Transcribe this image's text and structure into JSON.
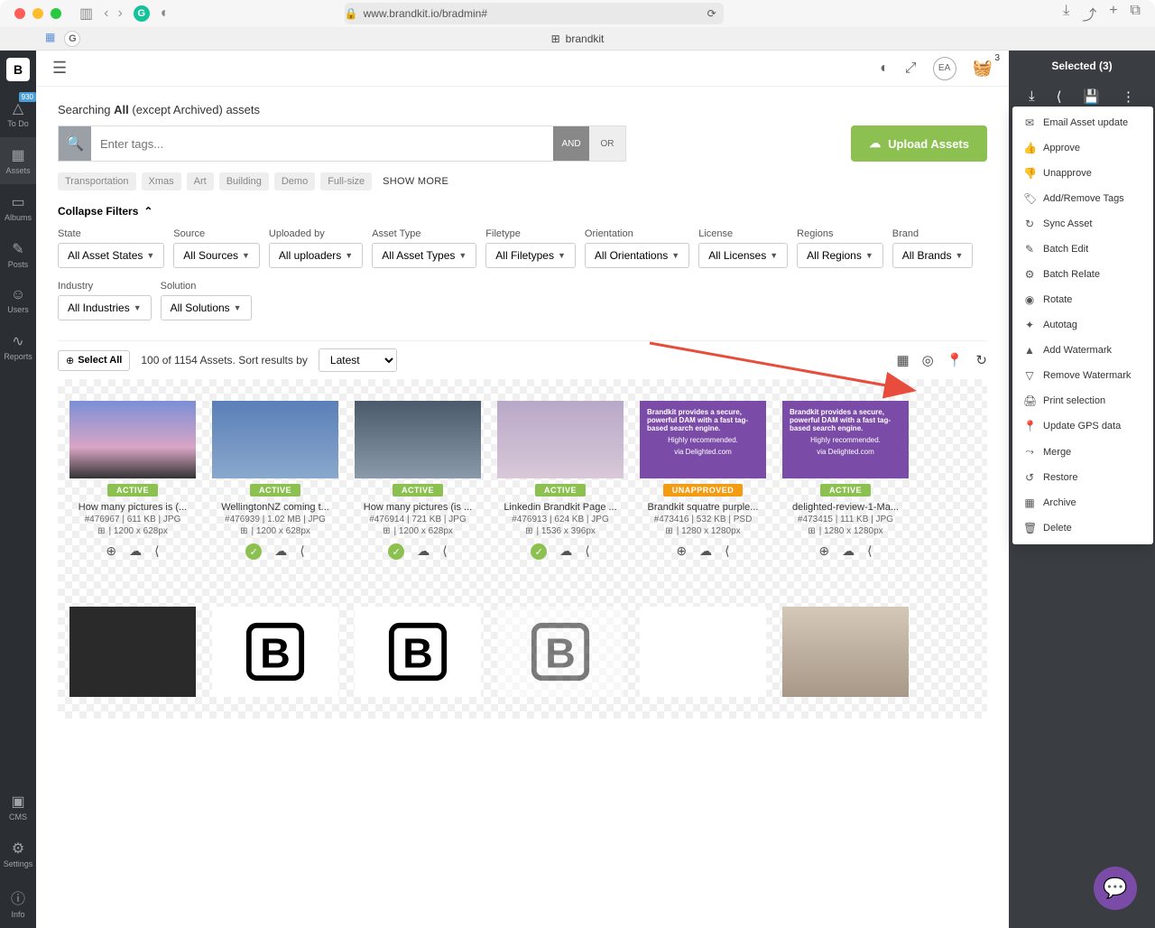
{
  "browser": {
    "url": "www.brandkit.io/bradmin#",
    "tab_title": "brandkit"
  },
  "sidebar": {
    "badge": "930",
    "items": [
      {
        "label": "To Do"
      },
      {
        "label": "Assets"
      },
      {
        "label": "Albums"
      },
      {
        "label": "Posts"
      },
      {
        "label": "Users"
      },
      {
        "label": "Reports"
      }
    ],
    "bottom_items": [
      {
        "label": "CMS"
      },
      {
        "label": "Settings"
      },
      {
        "label": "Info"
      }
    ]
  },
  "topbar": {
    "avatar": "EA",
    "basket_count": "3"
  },
  "search": {
    "heading_prefix": "Searching ",
    "heading_bold": "All",
    "heading_suffix": " (except Archived) assets",
    "placeholder": "Enter tags...",
    "and": "AND",
    "or": "OR",
    "upload_label": "Upload Assets"
  },
  "tags": [
    "Transportation",
    "Xmas",
    "Art",
    "Building",
    "Demo",
    "Full-size"
  ],
  "show_more": "SHOW MORE",
  "collapse_filters": "Collapse Filters",
  "filters": [
    {
      "label": "State",
      "value": "All Asset States"
    },
    {
      "label": "Source",
      "value": "All Sources"
    },
    {
      "label": "Uploaded by",
      "value": "All uploaders"
    },
    {
      "label": "Asset Type",
      "value": "All Asset Types"
    },
    {
      "label": "Filetype",
      "value": "All Filetypes"
    },
    {
      "label": "Orientation",
      "value": "All Orientations"
    },
    {
      "label": "License",
      "value": "All Licenses"
    },
    {
      "label": "Regions",
      "value": "All Regions"
    },
    {
      "label": "Brand",
      "value": "All Brands"
    },
    {
      "label": "Industry",
      "value": "All Industries"
    },
    {
      "label": "Solution",
      "value": "All Solutions"
    }
  ],
  "results": {
    "select_all": "Select All",
    "count_text": "100 of 1154 Assets. Sort results by",
    "sort": "Latest"
  },
  "assets": [
    {
      "title": "How many pictures is (...",
      "meta": "#476967 | 611 KB | JPG",
      "dims": "1200 x 628px",
      "status": "ACTIVE",
      "thumb": "gradient1",
      "selected": false
    },
    {
      "title": "WellingtonNZ coming t...",
      "meta": "#476939 | 1.02 MB | JPG",
      "dims": "1200 x 628px",
      "status": "ACTIVE",
      "thumb": "gradient2",
      "selected": true
    },
    {
      "title": "How many pictures (is ...",
      "meta": "#476914 | 721 KB | JPG",
      "dims": "1200 x 628px",
      "status": "ACTIVE",
      "thumb": "gradient3",
      "selected": true
    },
    {
      "title": "Linkedin Brandkit Page ...",
      "meta": "#476913 | 624 KB | JPG",
      "dims": "1536 x 396px",
      "status": "ACTIVE",
      "thumb": "gradient4",
      "selected": true
    },
    {
      "title": "Brandkit squatre purple...",
      "meta": "#473416 | 532 KB | PSD",
      "dims": "1280 x 1280px",
      "status": "UNAPPROVED",
      "thumb": "purple",
      "selected": false
    },
    {
      "title": "delighted-review-1-Ma...",
      "meta": "#473415 | 111 KB | JPG",
      "dims": "1280 x 1280px",
      "status": "ACTIVE",
      "thumb": "purple",
      "selected": false
    }
  ],
  "purple_text": {
    "line1": "Brandkit provides a secure, powerful DAM with a fast tag-based search engine.",
    "line2": "Highly recommended.",
    "line3": "via Delighted.com"
  },
  "panel": {
    "title": "Selected (3)",
    "menu": [
      {
        "icon": "✉",
        "label": "Email Asset update"
      },
      {
        "icon": "👍",
        "label": "Approve"
      },
      {
        "icon": "👎",
        "label": "Unapprove"
      },
      {
        "icon": "🏷",
        "label": "Add/Remove Tags"
      },
      {
        "icon": "↻",
        "label": "Sync Asset"
      },
      {
        "icon": "✎",
        "label": "Batch Edit"
      },
      {
        "icon": "⚙",
        "label": "Batch Relate"
      },
      {
        "icon": "◉",
        "label": "Rotate"
      },
      {
        "icon": "✦",
        "label": "Autotag"
      },
      {
        "icon": "▲",
        "label": "Add Watermark"
      },
      {
        "icon": "▽",
        "label": "Remove Watermark"
      },
      {
        "icon": "🖨",
        "label": "Print selection"
      },
      {
        "icon": "📍",
        "label": "Update GPS data"
      },
      {
        "icon": "⤳",
        "label": "Merge"
      },
      {
        "icon": "↺",
        "label": "Restore"
      },
      {
        "icon": "▦",
        "label": "Archive"
      },
      {
        "icon": "🗑",
        "label": "Delete"
      }
    ]
  }
}
